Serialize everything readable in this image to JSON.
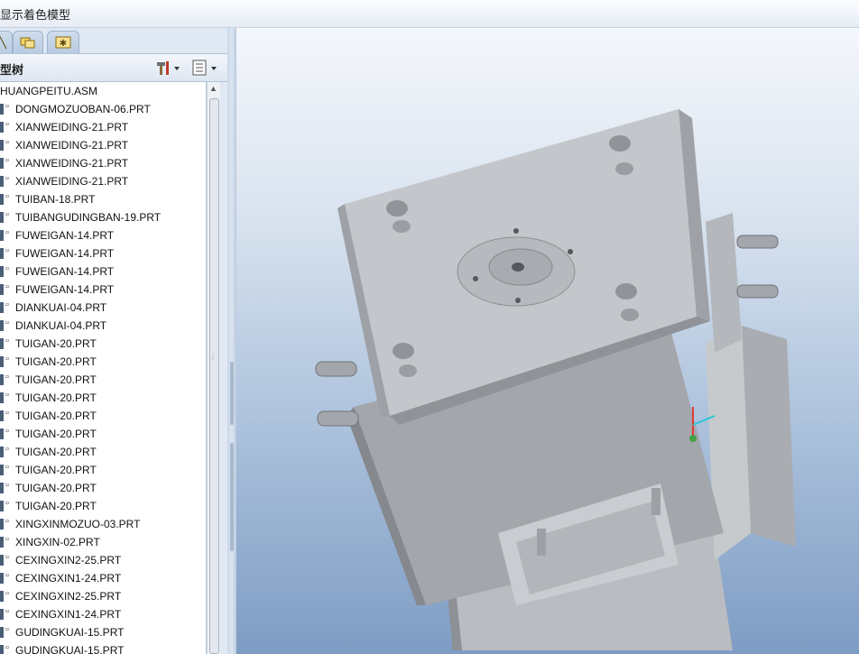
{
  "window": {
    "title": "显示着色模型"
  },
  "tabs": [
    {
      "name": "model-tree-tab",
      "icon": "tree-tab-icon"
    },
    {
      "name": "folder-browser-tab",
      "icon": "folder-icon"
    },
    {
      "name": "favorites-tab",
      "icon": "star-icon"
    }
  ],
  "panel": {
    "title": "型树",
    "tools_icon": "hammer-settings-icon",
    "show_icon": "list-icon"
  },
  "tree": {
    "root": "HUANGPEITU.ASM",
    "items": [
      "DONGMOZUOBAN-06.PRT",
      "XIANWEIDING-21.PRT",
      "XIANWEIDING-21.PRT",
      "XIANWEIDING-21.PRT",
      "XIANWEIDING-21.PRT",
      "TUIBAN-18.PRT",
      "TUIBANGUDINGBAN-19.PRT",
      "FUWEIGAN-14.PRT",
      "FUWEIGAN-14.PRT",
      "FUWEIGAN-14.PRT",
      "FUWEIGAN-14.PRT",
      "DIANKUAI-04.PRT",
      "DIANKUAI-04.PRT",
      "TUIGAN-20.PRT",
      "TUIGAN-20.PRT",
      "TUIGAN-20.PRT",
      "TUIGAN-20.PRT",
      "TUIGAN-20.PRT",
      "TUIGAN-20.PRT",
      "TUIGAN-20.PRT",
      "TUIGAN-20.PRT",
      "TUIGAN-20.PRT",
      "TUIGAN-20.PRT",
      "XINGXINMOZUO-03.PRT",
      "XINGXIN-02.PRT",
      "CEXINGXIN2-25.PRT",
      "CEXINGXIN1-24.PRT",
      "CEXINGXIN2-25.PRT",
      "CEXINGXIN1-24.PRT",
      "GUDINGKUAI-15.PRT",
      "GUDINGKUAI-15.PRT"
    ]
  },
  "viewport": {
    "content": "shaded-3d-mold-assembly",
    "axis_colors": {
      "x": "#26c6da",
      "y": "#e53935",
      "z": "#43a047"
    }
  }
}
